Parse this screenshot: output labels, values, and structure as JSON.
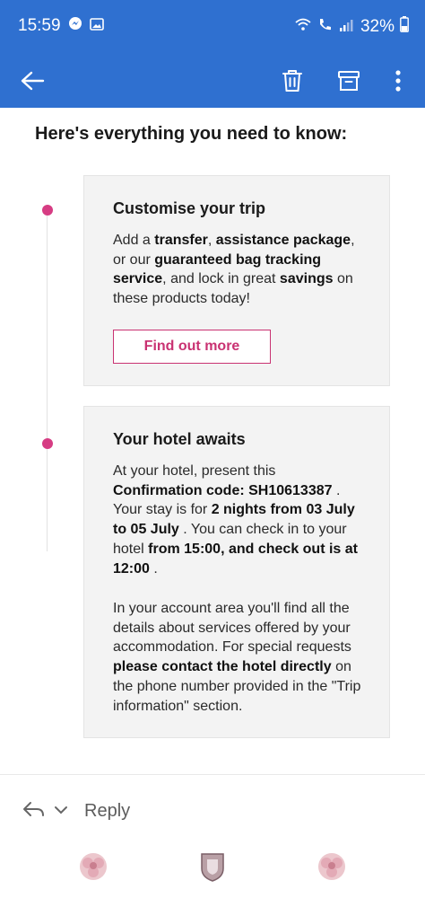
{
  "status_bar": {
    "time": "15:59",
    "battery": "32%"
  },
  "app_bar": {
    "icons": [
      "back-arrow-icon",
      "trash-icon",
      "archive-icon",
      "more-vert-icon"
    ]
  },
  "email": {
    "heading": "Here's everything you need to know:",
    "card1": {
      "title": "Customise your trip",
      "body_parts": [
        "Add a ",
        "transfer",
        ", ",
        "assistance package",
        ", or our ",
        "guaranteed bag tracking service",
        ", and lock in great ",
        "savings",
        " on these products today!"
      ],
      "button_label": "Find out more"
    },
    "card2": {
      "title": "Your hotel awaits",
      "p1_parts": [
        "At your hotel, present this ",
        "Confirmation code: SH10613387",
        " . Your stay is for ",
        "2 nights from 03 July to 05 July",
        " . You can check in to your hotel ",
        "from 15:00, and check out is at 12:00",
        " ."
      ],
      "p2_parts": [
        "In your account area you'll find all the details about services offered by your accommodation. For special requests ",
        "please contact the hotel directly",
        " on the phone number provided in the \"Trip information\" section."
      ]
    }
  },
  "reply": {
    "label": "Reply"
  },
  "colors": {
    "app_bar": "#2f70d0",
    "accent": "#d63c83",
    "button_text": "#c93272",
    "card_bg": "#f3f3f3"
  }
}
